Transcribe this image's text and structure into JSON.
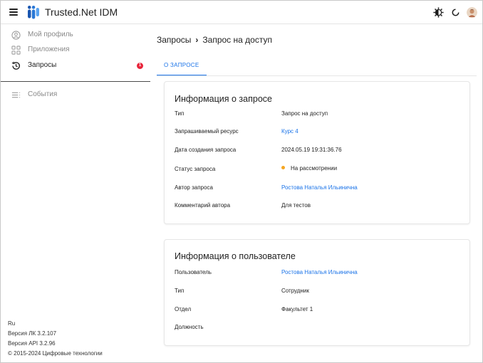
{
  "header": {
    "title": "Trusted.Net IDM",
    "icons": {
      "menu": "menu-icon",
      "theme": "theme-icon",
      "refresh": "refresh-icon",
      "avatar": "avatar"
    }
  },
  "sidebar": {
    "items": [
      {
        "label": "Мой профиль",
        "icon": "profile-icon"
      },
      {
        "label": "Приложения",
        "icon": "apps-icon"
      },
      {
        "label": "Запросы",
        "icon": "history-icon",
        "badge": "1"
      },
      {
        "label": "События",
        "icon": "events-icon"
      }
    ],
    "footer": {
      "lang": "Ru",
      "lk_version": "Версия ЛК 3.2.107",
      "api_version": "Версия API 3.2.96",
      "copyright": "© 2015-2024 Цифровые технологии"
    }
  },
  "breadcrumb": {
    "parent": "Запросы",
    "current": "Запрос на доступ"
  },
  "tabs": [
    {
      "label": "О ЗАПРОСЕ",
      "active": true
    }
  ],
  "request_card": {
    "title": "Информация о запросе",
    "rows": [
      {
        "label": "Тип",
        "value": "Запрос на доступ"
      },
      {
        "label": "Запрашиваемый ресурс",
        "value": "Курс 4"
      },
      {
        "label": "Дата создания запроса",
        "value": "2024.05.19 19:31:36.76"
      },
      {
        "label": "Статус запроса",
        "value": "На рассмотрении"
      },
      {
        "label": "Автор запроса",
        "value": "Ростова Наталья Ильинична"
      },
      {
        "label": "Комментарий автора",
        "value": "Для тестов"
      }
    ]
  },
  "user_card": {
    "title": "Информация о пользователе",
    "rows": [
      {
        "label": "Пользователь",
        "value": "Ростова Наталья Ильинична"
      },
      {
        "label": "Тип",
        "value": "Сотрудник"
      },
      {
        "label": "Отдел",
        "value": "Факультет 1"
      },
      {
        "label": "Должность",
        "value": ""
      }
    ]
  },
  "colors": {
    "accent": "#1a73e8",
    "badge": "#e8253b",
    "status_pending": "#f5a623"
  }
}
